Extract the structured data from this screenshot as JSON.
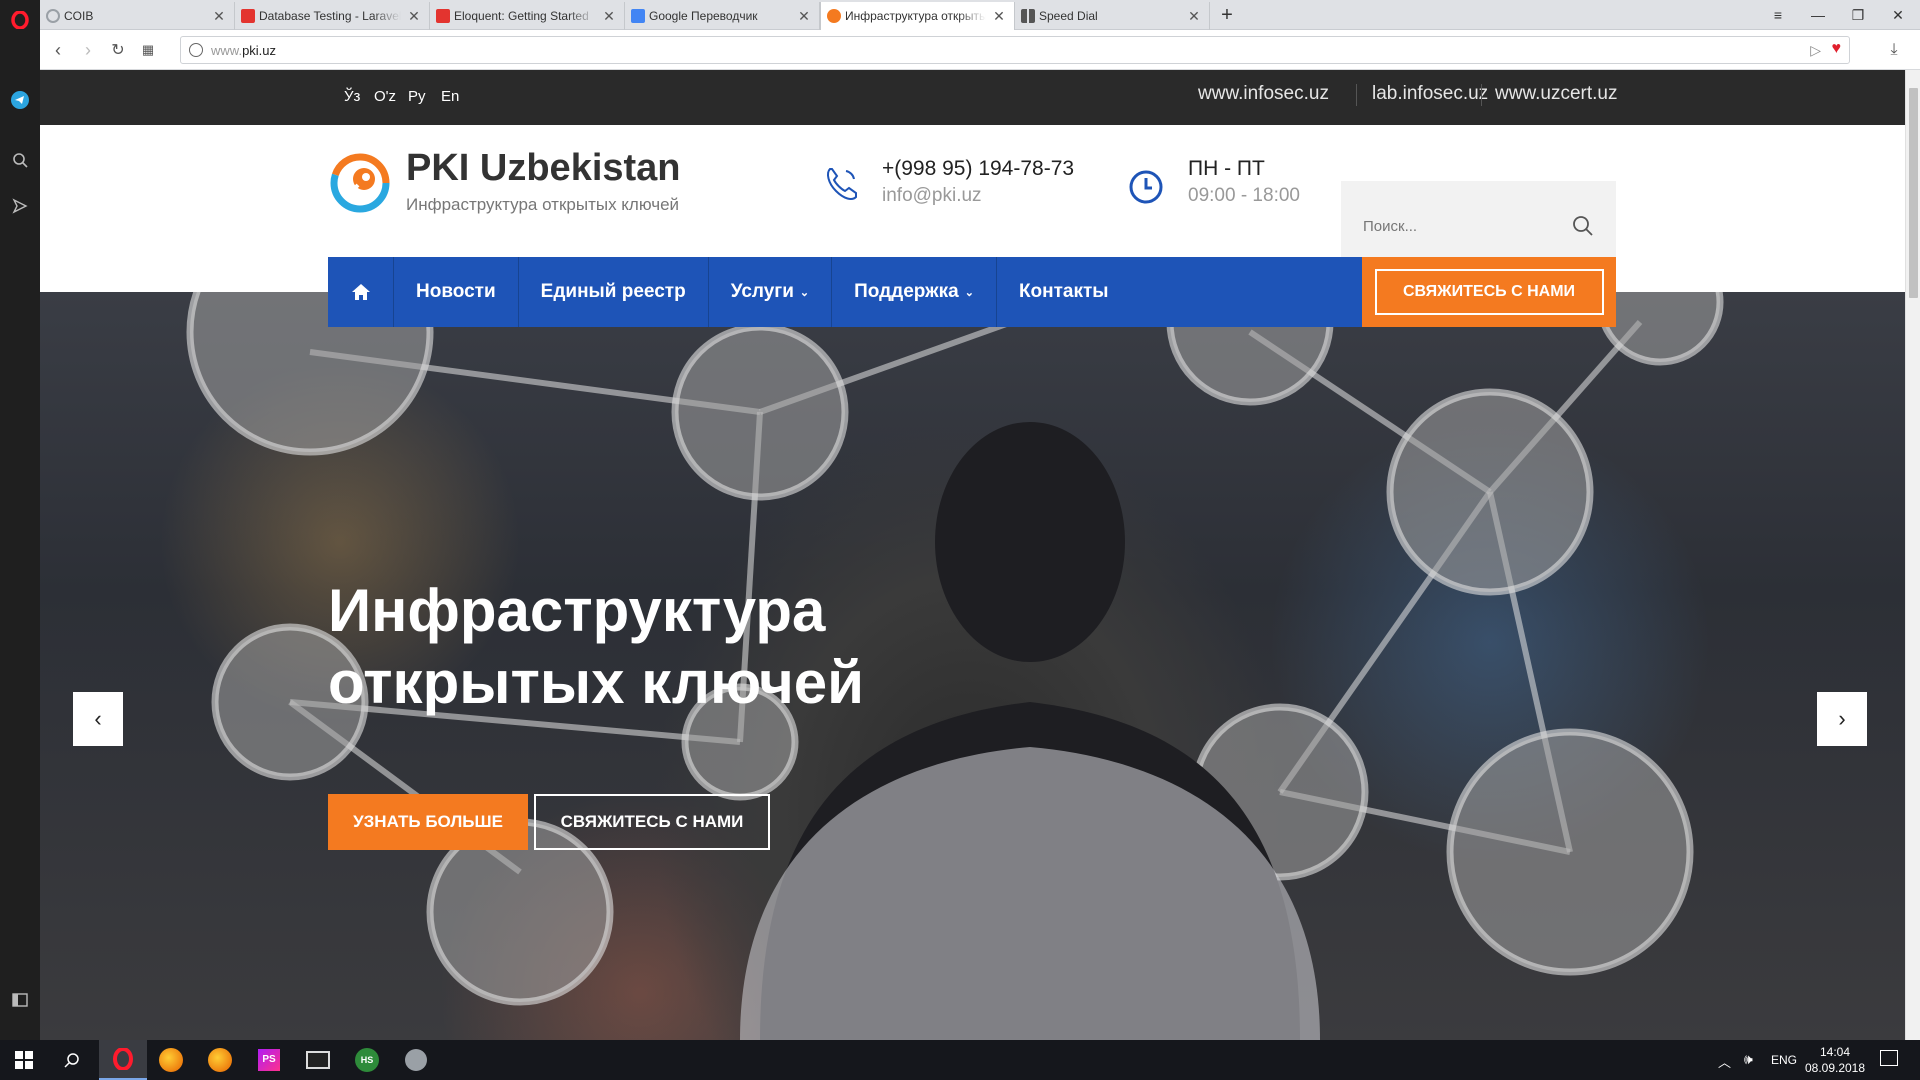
{
  "browser": {
    "tabs": [
      {
        "title": "COIB",
        "favicon_color": "#9aa0a6"
      },
      {
        "title": "Database Testing - Laravel",
        "favicon_color": "#e3342f"
      },
      {
        "title": "Eloquent: Getting Started",
        "favicon_color": "#e3342f"
      },
      {
        "title": "Google Переводчик",
        "favicon_color": "#4285f4"
      },
      {
        "title": "Инфраструктура открытых",
        "favicon_color": "#f47a20"
      },
      {
        "title": "Speed Dial",
        "favicon_color": "#555555"
      }
    ],
    "url_prefix": "www.",
    "url_host": "pki.uz"
  },
  "site": {
    "langs": [
      "Ўз",
      "O'z",
      "Ру",
      "En"
    ],
    "top_links": [
      "www.infosec.uz",
      "lab.infosec.uz",
      "www.uzcert.uz"
    ],
    "logo_title": "PKI Uzbekistan",
    "logo_subtitle": "Инфраструктура открытых ключей",
    "phone": "+(998 95) 194-78-73",
    "email": "info@pki.uz",
    "hours_days": "ПН - ПТ",
    "hours_time": "09:00 - 18:00",
    "search_placeholder": "Поиск...",
    "nav": [
      "Новости",
      "Единый реестр",
      "Услуги",
      "Поддержка",
      "Контакты"
    ],
    "nav_cta": "СВЯЖИТЕСЬ С НАМИ",
    "hero_title_line1": "Инфраструктура",
    "hero_title_line2": "открытых ключей",
    "hero_btn_more": "УЗНАТЬ БОЛЬШЕ",
    "hero_btn_contact": "СВЯЖИТЕСЬ С НАМИ",
    "colors": {
      "brand_blue": "#1e54b7",
      "accent_orange": "#f47a20",
      "top_strip": "#2a2a2a"
    }
  },
  "taskbar": {
    "lang": "ENG",
    "time": "14:04",
    "date": "08.09.2018"
  }
}
